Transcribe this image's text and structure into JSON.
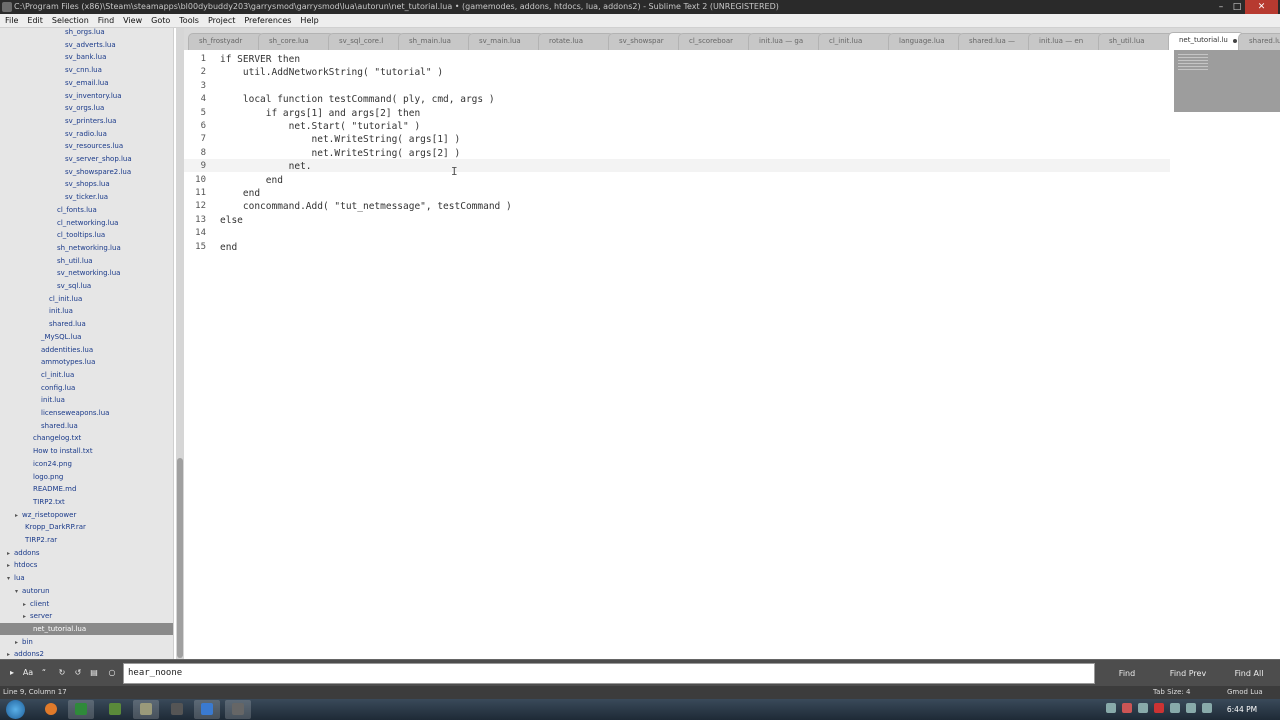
{
  "window": {
    "title": "C:\\Program Files (x86)\\Steam\\steamapps\\bl00dybuddy203\\garrysmod\\garrysmod\\lua\\autorun\\net_tutorial.lua • (gamemodes, addons, htdocs, lua, addons2) - Sublime Text 2 (UNREGISTERED)"
  },
  "menu": [
    "File",
    "Edit",
    "Selection",
    "Find",
    "View",
    "Goto",
    "Tools",
    "Project",
    "Preferences",
    "Help"
  ],
  "sidebar": {
    "items": [
      {
        "label": "sh_orgs.lua",
        "indent": 65
      },
      {
        "label": "sv_adverts.lua",
        "indent": 65
      },
      {
        "label": "sv_bank.lua",
        "indent": 65
      },
      {
        "label": "sv_cnn.lua",
        "indent": 65
      },
      {
        "label": "sv_email.lua",
        "indent": 65
      },
      {
        "label": "sv_inventory.lua",
        "indent": 65
      },
      {
        "label": "sv_orgs.lua",
        "indent": 65
      },
      {
        "label": "sv_printers.lua",
        "indent": 65
      },
      {
        "label": "sv_radio.lua",
        "indent": 65
      },
      {
        "label": "sv_resources.lua",
        "indent": 65
      },
      {
        "label": "sv_server_shop.lua",
        "indent": 65
      },
      {
        "label": "sv_showspare2.lua",
        "indent": 65
      },
      {
        "label": "sv_shops.lua",
        "indent": 65
      },
      {
        "label": "sv_ticker.lua",
        "indent": 65
      },
      {
        "label": "cl_fonts.lua",
        "indent": 57
      },
      {
        "label": "cl_networking.lua",
        "indent": 57
      },
      {
        "label": "cl_tooltips.lua",
        "indent": 57
      },
      {
        "label": "sh_networking.lua",
        "indent": 57
      },
      {
        "label": "sh_util.lua",
        "indent": 57
      },
      {
        "label": "sv_networking.lua",
        "indent": 57
      },
      {
        "label": "sv_sql.lua",
        "indent": 57
      },
      {
        "label": "cl_init.lua",
        "indent": 49
      },
      {
        "label": "init.lua",
        "indent": 49
      },
      {
        "label": "shared.lua",
        "indent": 49
      },
      {
        "label": "_MySQL.lua",
        "indent": 41
      },
      {
        "label": "addentities.lua",
        "indent": 41
      },
      {
        "label": "ammotypes.lua",
        "indent": 41
      },
      {
        "label": "cl_init.lua",
        "indent": 41
      },
      {
        "label": "config.lua",
        "indent": 41
      },
      {
        "label": "init.lua",
        "indent": 41
      },
      {
        "label": "licenseweapons.lua",
        "indent": 41
      },
      {
        "label": "shared.lua",
        "indent": 41
      },
      {
        "label": "changelog.txt",
        "indent": 33
      },
      {
        "label": "How to install.txt",
        "indent": 33
      },
      {
        "label": "icon24.png",
        "indent": 33
      },
      {
        "label": "logo.png",
        "indent": 33
      },
      {
        "label": "README.md",
        "indent": 33
      },
      {
        "label": "TIRP2.txt",
        "indent": 33
      },
      {
        "label": "wz_risetopower",
        "indent": 17,
        "folder": "closed"
      },
      {
        "label": "Kropp_DarkRP.rar",
        "indent": 25
      },
      {
        "label": "TIRP2.rar",
        "indent": 25
      },
      {
        "label": "addons",
        "indent": 9,
        "folder": "closed"
      },
      {
        "label": "htdocs",
        "indent": 9,
        "folder": "closed"
      },
      {
        "label": "lua",
        "indent": 9,
        "folder": "open"
      },
      {
        "label": "autorun",
        "indent": 17,
        "folder": "open"
      },
      {
        "label": "client",
        "indent": 25,
        "folder": "closed"
      },
      {
        "label": "server",
        "indent": 25,
        "folder": "closed"
      },
      {
        "label": "net_tutorial.lua",
        "indent": 33,
        "selected": true
      },
      {
        "label": "bin",
        "indent": 17,
        "folder": "closed"
      },
      {
        "label": "addons2",
        "indent": 9,
        "folder": "closed"
      }
    ]
  },
  "tabs": [
    {
      "label": "sh_frostyadr"
    },
    {
      "label": "sh_core.lua"
    },
    {
      "label": "sv_sql_core.l"
    },
    {
      "label": "sh_main.lua"
    },
    {
      "label": "sv_main.lua"
    },
    {
      "label": "rotate.lua"
    },
    {
      "label": "sv_showspar"
    },
    {
      "label": "cl_scoreboar"
    },
    {
      "label": "init.lua — ga"
    },
    {
      "label": "cl_init.lua"
    },
    {
      "label": "language.lua"
    },
    {
      "label": "shared.lua —"
    },
    {
      "label": "init.lua — en"
    },
    {
      "label": "sh_util.lua"
    },
    {
      "label": "net_tutorial.lu",
      "active": true
    },
    {
      "label": "shared.lua —"
    }
  ],
  "editor": {
    "lines": [
      {
        "n": "1",
        "text": "if SERVER then"
      },
      {
        "n": "2",
        "text": "    util.AddNetworkString( \"tutorial\" )"
      },
      {
        "n": "3",
        "text": ""
      },
      {
        "n": "4",
        "text": "    local function testCommand( ply, cmd, args )"
      },
      {
        "n": "5",
        "text": "        if args[1] and args[2] then"
      },
      {
        "n": "6",
        "text": "            net.Start( \"tutorial\" )"
      },
      {
        "n": "7",
        "text": "                net.WriteString( args[1] )"
      },
      {
        "n": "8",
        "text": "                net.WriteString( args[2] )"
      },
      {
        "n": "9",
        "text": "            net."
      },
      {
        "n": "10",
        "text": "        end"
      },
      {
        "n": "11",
        "text": "    end"
      },
      {
        "n": "12",
        "text": "    concommand.Add( \"tut_netmessage\", testCommand )"
      },
      {
        "n": "13",
        "text": "else"
      },
      {
        "n": "14",
        "text": ""
      },
      {
        "n": "15",
        "text": "end"
      }
    ]
  },
  "find": {
    "query": "hear_noone",
    "find_label": "Find",
    "find_prev_label": "Find Prev",
    "find_all_label": "Find All",
    "options": [
      "regex-icon",
      "case-icon",
      "whole-word-icon",
      "wrap-icon",
      "in-selection-icon",
      "highlight-icon",
      "checkbox-icon"
    ]
  },
  "status": {
    "position": "Line 9, Column 17",
    "tab_size": "Tab Size: 4",
    "syntax": "Gmod Lua"
  },
  "taskbar": {
    "time": "6:44 PM"
  }
}
